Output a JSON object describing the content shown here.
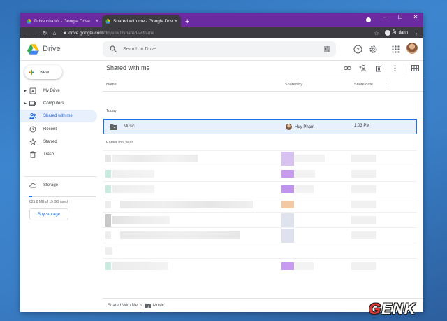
{
  "browser": {
    "tabs": [
      {
        "label": "Drive của tôi - Google Drive",
        "active": false
      },
      {
        "label": "Shared with me - Google Drive",
        "active": true
      }
    ],
    "close_glyph": "×",
    "new_tab_glyph": "+",
    "window_controls": [
      "–",
      "☐",
      "✕"
    ],
    "url_host": "drive.google.com",
    "url_path": "/drive/u/1/shared-with-me",
    "profile_label": "Ẩn danh"
  },
  "drive": {
    "logo_text": "Drive",
    "search_placeholder": "Search in Drive",
    "new_button": "New",
    "nav": [
      {
        "label": "My Drive",
        "icon": "my-drive-icon",
        "expandable": true,
        "active": false
      },
      {
        "label": "Computers",
        "icon": "computers-icon",
        "expandable": true,
        "active": false
      },
      {
        "label": "Shared with me",
        "icon": "shared-icon",
        "expandable": false,
        "active": true
      },
      {
        "label": "Recent",
        "icon": "clock-icon",
        "expandable": false,
        "active": false
      },
      {
        "label": "Starred",
        "icon": "star-icon",
        "expandable": false,
        "active": false
      },
      {
        "label": "Trash",
        "icon": "trash-icon",
        "expandable": false,
        "active": false
      }
    ],
    "storage_label": "Storage",
    "storage_used_text": "625.8 MB of 15 GB used",
    "storage_fraction": 0.042,
    "buy_storage": "Buy storage"
  },
  "main": {
    "title": "Shared with me",
    "columns": {
      "name": "Name",
      "shared_by": "Shared by",
      "share_date": "Share date"
    },
    "sort_glyph": "↓",
    "section_today": "Today",
    "section_earlier": "Earlier this year",
    "selected_file": {
      "name": "Music",
      "owner": "Huy Phạm",
      "date": "1:03 PM"
    },
    "breadcrumb": {
      "root": "Shared With Me",
      "separator": "›",
      "current": "Music"
    }
  },
  "watermark": {
    "first": "G",
    "rest": "ENK"
  },
  "colors": {
    "accent": "#1a73e8",
    "selected_bg": "#e8f0fe",
    "titlebar": "#6b2aa0"
  }
}
